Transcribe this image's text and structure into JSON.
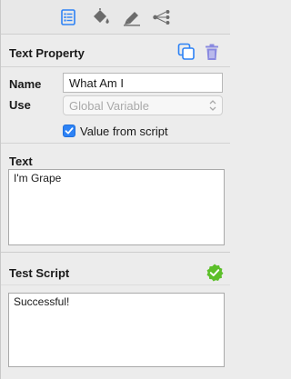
{
  "toolbar": {
    "icons": [
      "list-icon",
      "paint-bucket-icon",
      "highlighter-icon",
      "node-graph-icon"
    ],
    "active_index": 0
  },
  "text_property": {
    "title": "Text Property",
    "name_label": "Name",
    "name_value": "What Am I",
    "use_label": "Use",
    "use_value": "Global Variable",
    "value_from_script_label": "Value from script",
    "value_from_script_checked": true
  },
  "text_section": {
    "title": "Text",
    "value": "I'm Grape"
  },
  "test_script": {
    "title": "Test Script",
    "status_icon": "check-icon",
    "output": "Successful!"
  },
  "colors": {
    "accent": "#2d82f5",
    "success": "#5cbf2a",
    "trash": "#8a8ae0"
  }
}
